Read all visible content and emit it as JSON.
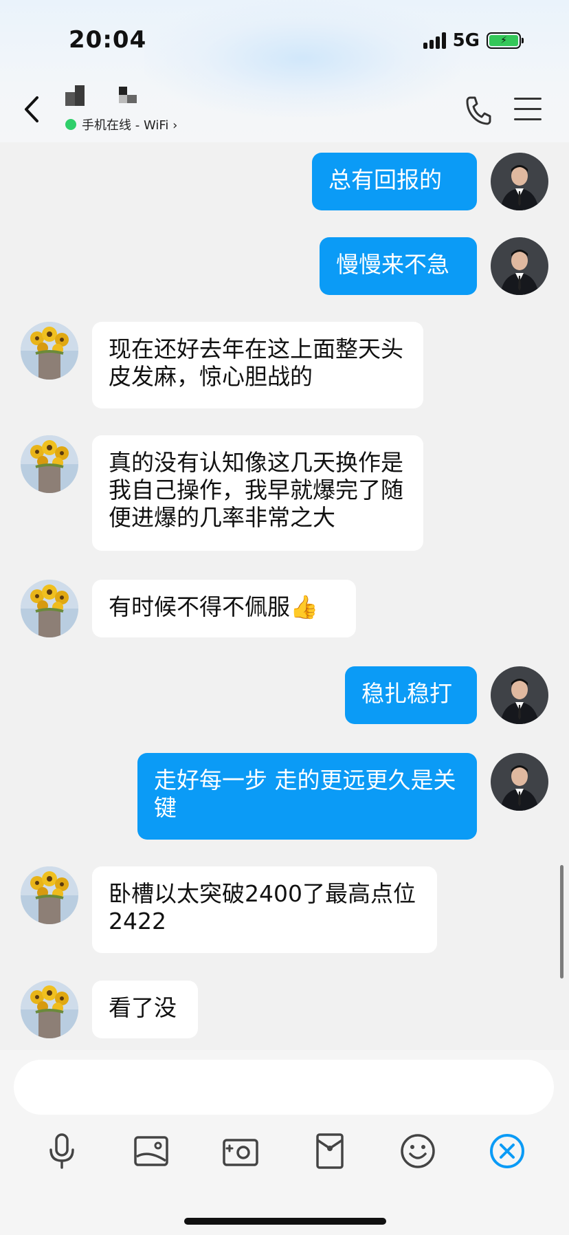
{
  "status_bar": {
    "time": "20:04",
    "network": "5G"
  },
  "header": {
    "online_status": "手机在线 - WiFi ›"
  },
  "messages": [
    {
      "side": "out",
      "text": "总有回报的"
    },
    {
      "side": "out",
      "text": "慢慢来不急"
    },
    {
      "side": "in",
      "text": "现在还好去年在这上面整天头皮发麻，惊心胆战的"
    },
    {
      "side": "in",
      "text": "真的没有认知像这几天换作是我自己操作，我早就爆完了随便进爆的几率非常之大"
    },
    {
      "side": "in",
      "text": "有时候不得不佩服👍"
    },
    {
      "side": "out",
      "text": "稳扎稳打"
    },
    {
      "side": "out",
      "text": "走好每一步 走的更远更久是关键"
    },
    {
      "side": "in",
      "text": "卧槽以太突破2400了最高点位2422"
    },
    {
      "side": "in",
      "text": "看了没"
    }
  ],
  "input": {
    "placeholder": ""
  },
  "toolbar": {
    "icons": [
      "microphone-icon",
      "image-icon",
      "camera-icon",
      "red-packet-icon",
      "emoji-icon",
      "close-icon"
    ]
  },
  "colors": {
    "outgoing_bubble": "#0b9bf6",
    "incoming_bubble": "#ffffff",
    "online_dot": "#2fcf6a",
    "accent": "#0b9bf6"
  }
}
